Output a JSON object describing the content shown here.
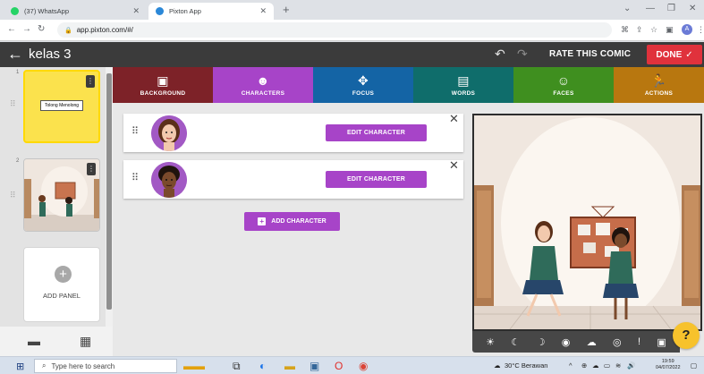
{
  "browser": {
    "tabs": [
      {
        "title": "(37) WhatsApp",
        "favicon_color": "#25d366"
      },
      {
        "title": "Pixton App",
        "favicon_color": "#2b88d8",
        "active": true
      }
    ],
    "url": "app.pixton.com/#/"
  },
  "app": {
    "title": "kelas 3",
    "rate_label": "RATE THIS COMIC",
    "done_label": "DONE"
  },
  "panels": {
    "items": [
      {
        "number": "1",
        "caption": "Tolong Menolong"
      },
      {
        "number": "2"
      }
    ],
    "add_label": "ADD PANEL"
  },
  "categories": [
    {
      "label": "BACKGROUND",
      "color": "#7d2228",
      "icon": "image-icon"
    },
    {
      "label": "CHARACTERS",
      "color": "#a744c8",
      "icon": "face-icon"
    },
    {
      "label": "FOCUS",
      "color": "#1464a5",
      "icon": "move-icon"
    },
    {
      "label": "WORDS",
      "color": "#0f6d6b",
      "icon": "speech-icon"
    },
    {
      "label": "FACES",
      "color": "#3f8f1f",
      "icon": "smile-icon"
    },
    {
      "label": "ACTIONS",
      "color": "#b8770f",
      "icon": "run-icon"
    }
  ],
  "characters": {
    "rows": [
      {
        "edit_label": "EDIT CHARACTER"
      },
      {
        "edit_label": "EDIT CHARACTER"
      }
    ],
    "add_label": "ADD CHARACTER"
  },
  "help_label": "?",
  "taskbar": {
    "search_placeholder": "Type here to search",
    "weather": "30°C Berawan",
    "time": "19:59",
    "date": "04/07/2022"
  }
}
